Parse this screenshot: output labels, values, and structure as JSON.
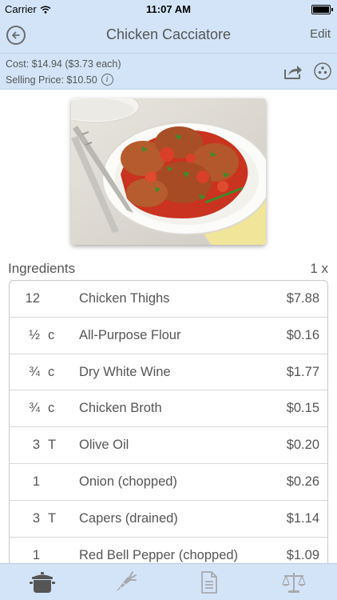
{
  "status_bar": {
    "carrier": "Carrier",
    "time": "11:07 AM"
  },
  "nav": {
    "title": "Chicken Cacciatore",
    "edit_label": "Edit"
  },
  "cost": {
    "cost_text": "Cost: $14.94 ($3.73 each)",
    "selling_price_text": "Selling Price: $10.50"
  },
  "ingredients": {
    "header": "Ingredients",
    "multiplier": "1 x",
    "items": [
      {
        "qty": "12",
        "unit": "",
        "name": "Chicken Thighs",
        "price": "$7.88"
      },
      {
        "qty": "½",
        "unit": "c",
        "name": "All-Purpose Flour",
        "price": "$0.16"
      },
      {
        "qty": "¾",
        "unit": "c",
        "name": "Dry White Wine",
        "price": "$1.77"
      },
      {
        "qty": "¾",
        "unit": "c",
        "name": "Chicken Broth",
        "price": "$0.15"
      },
      {
        "qty": "3",
        "unit": "T",
        "name": "Olive Oil",
        "price": "$0.20"
      },
      {
        "qty": "1",
        "unit": "",
        "name": "Onion (chopped)",
        "price": "$0.26"
      },
      {
        "qty": "3",
        "unit": "T",
        "name": "Capers (drained)",
        "price": "$1.14"
      },
      {
        "qty": "1",
        "unit": "",
        "name": "Red Bell Pepper (chopped)",
        "price": "$1.09"
      }
    ]
  },
  "tabs": [
    {
      "icon": "pot-icon",
      "active": true
    },
    {
      "icon": "carrot-icon",
      "active": false
    },
    {
      "icon": "document-icon",
      "active": false
    },
    {
      "icon": "scales-icon",
      "active": false
    }
  ],
  "colors": {
    "bar_background": "#d3e4f8",
    "text": "#555555",
    "icon": "#6b6b6b"
  }
}
